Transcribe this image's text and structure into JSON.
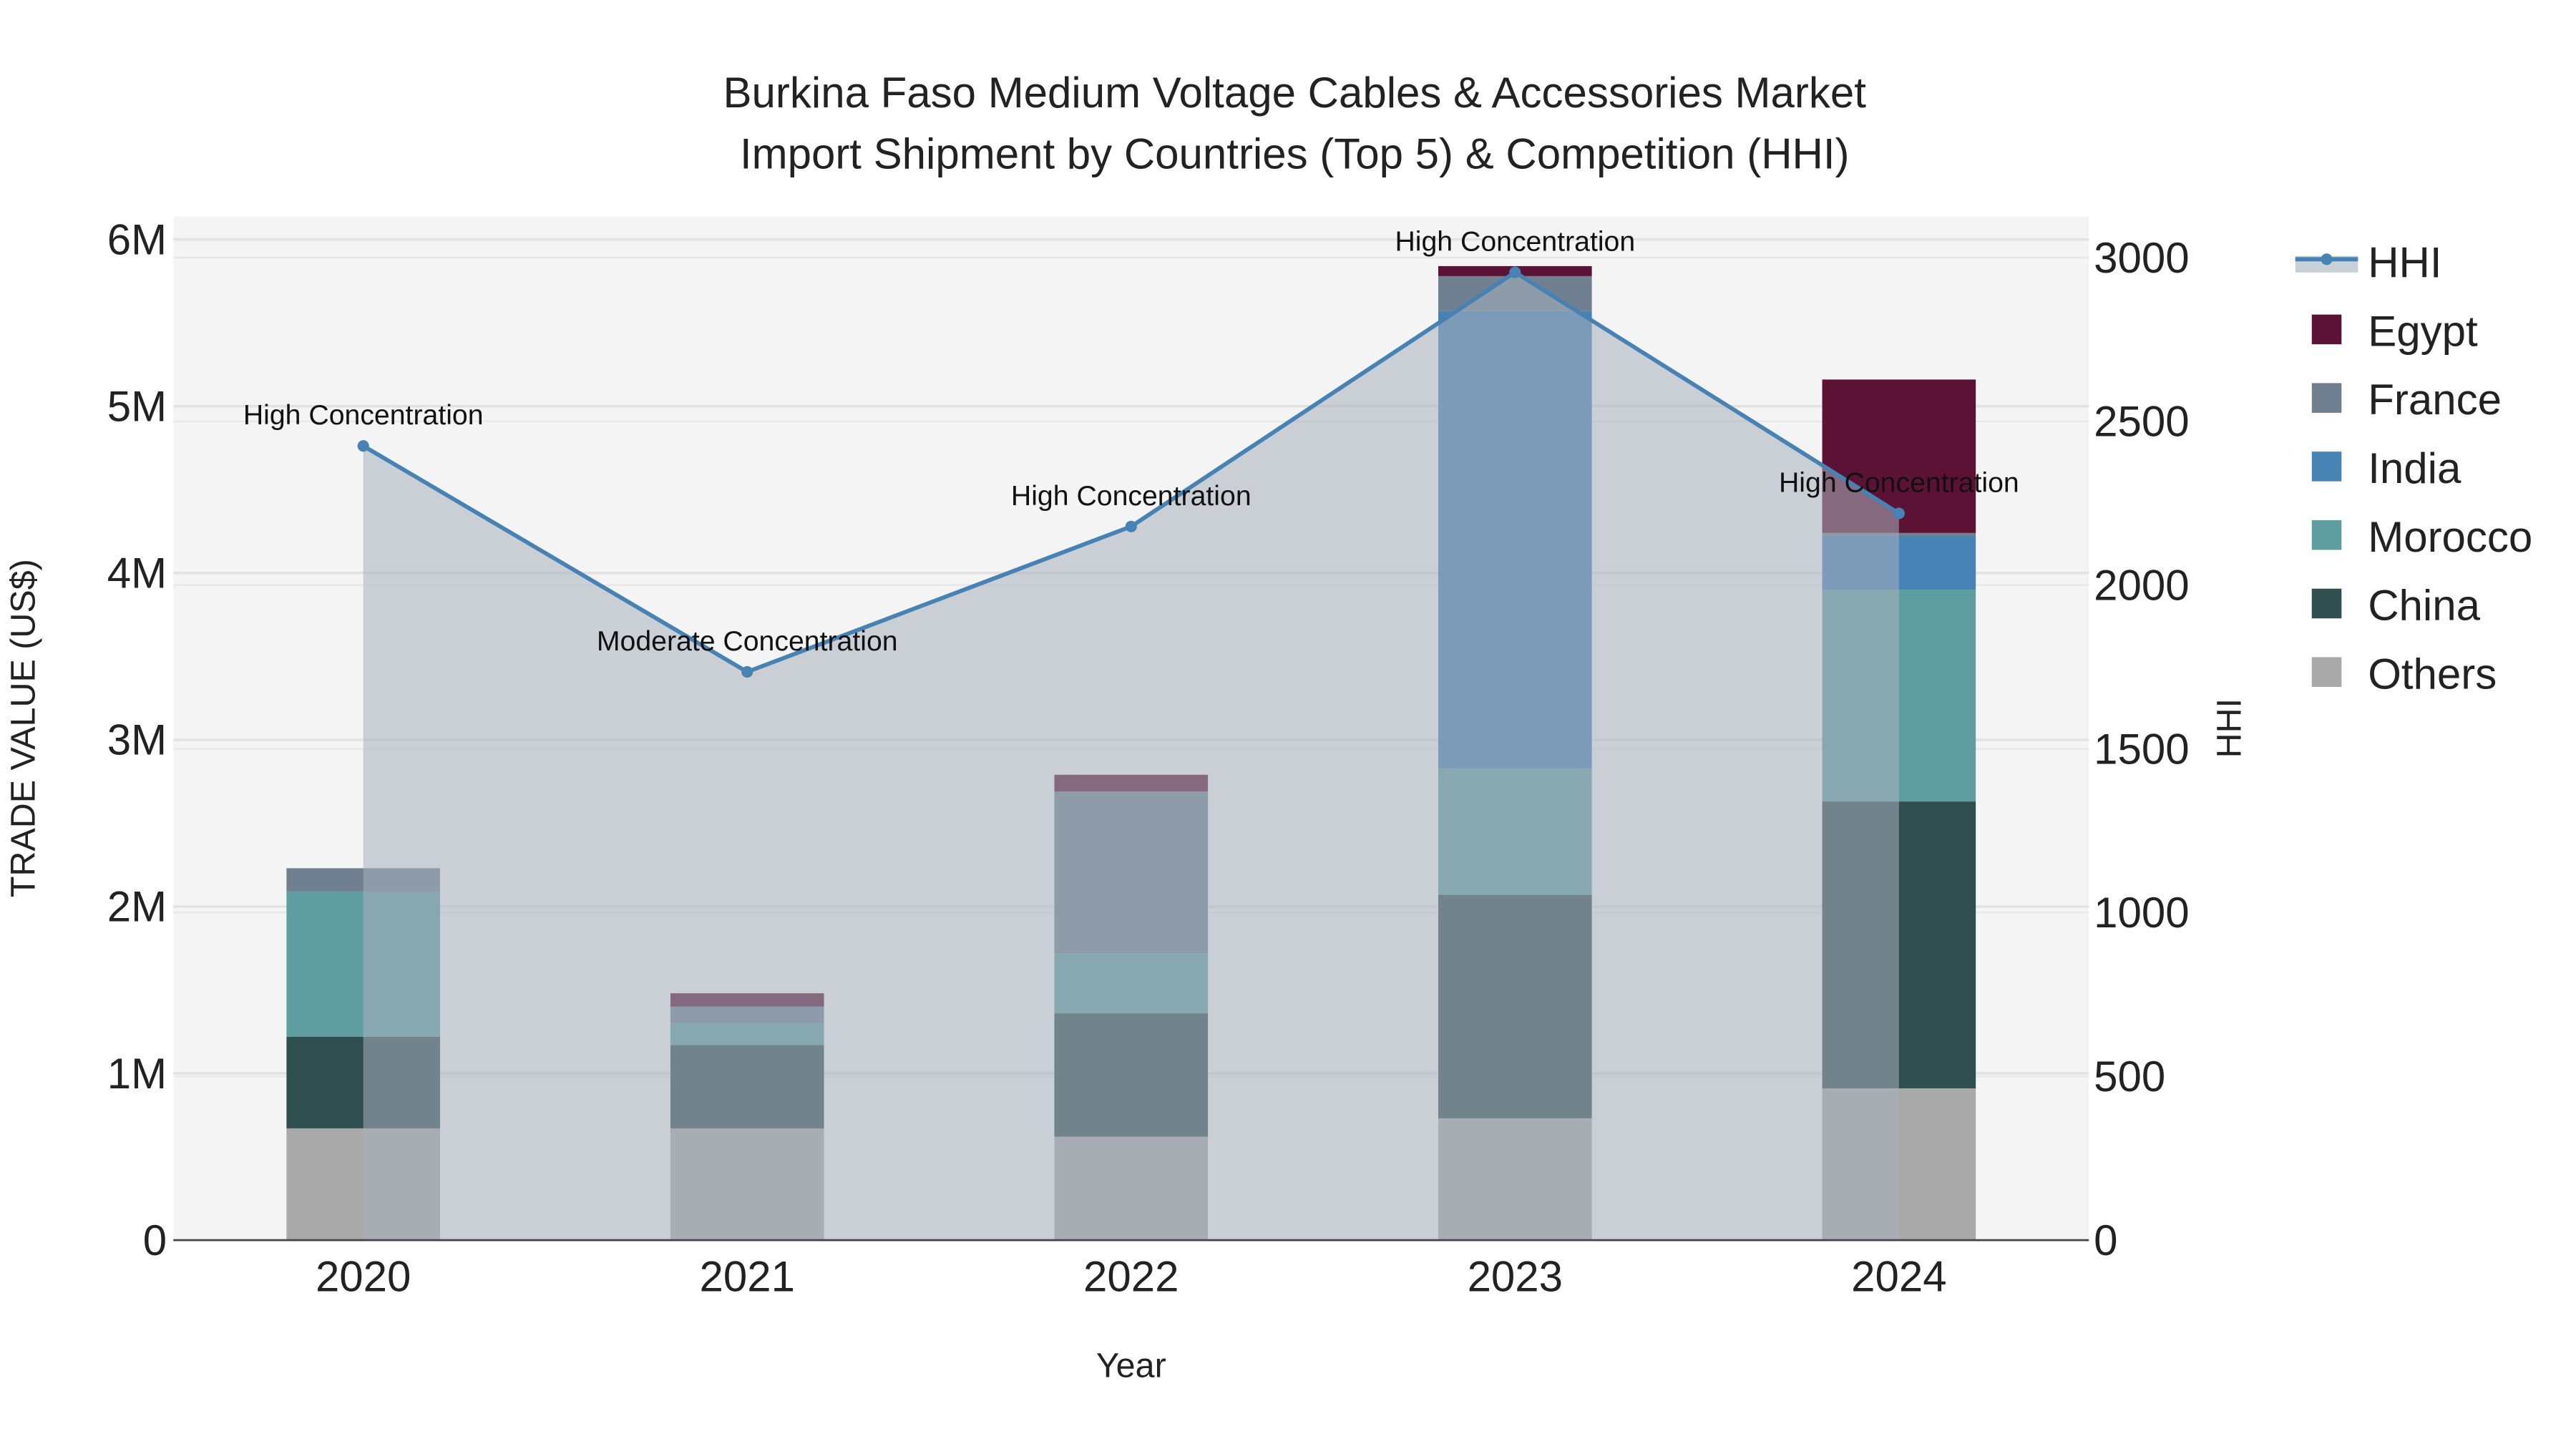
{
  "chart_data": {
    "type": "bar",
    "title": "Burkina Faso Medium Voltage Cables & Accessories Market",
    "subtitle": "Import Shipment by Countries (Top 5) & Competition (HHI)",
    "xlabel": "Year",
    "ylabel": "TRADE VALUE (US$)",
    "y2label": "HHI",
    "categories": [
      "2020",
      "2021",
      "2022",
      "2023",
      "2024"
    ],
    "ylim": [
      0,
      6100000
    ],
    "y2lim": [
      0,
      3050
    ],
    "yticks": [
      {
        "v": 0,
        "label": "0"
      },
      {
        "v": 1000000,
        "label": "1M"
      },
      {
        "v": 2000000,
        "label": "2M"
      },
      {
        "v": 3000000,
        "label": "3M"
      },
      {
        "v": 4000000,
        "label": "4M"
      },
      {
        "v": 5000000,
        "label": "5M"
      },
      {
        "v": 6000000,
        "label": "6M"
      }
    ],
    "y2ticks": [
      {
        "v": 0,
        "label": "0"
      },
      {
        "v": 500,
        "label": "500"
      },
      {
        "v": 1000,
        "label": "1000"
      },
      {
        "v": 1500,
        "label": "1500"
      },
      {
        "v": 2000,
        "label": "2000"
      },
      {
        "v": 2500,
        "label": "2500"
      },
      {
        "v": 3000,
        "label": "3000"
      }
    ],
    "grid": true,
    "legend_position": "right",
    "series": [
      {
        "name": "Others",
        "color": "#a9a9a9",
        "values": [
          670000,
          670000,
          620000,
          730000,
          910000
        ]
      },
      {
        "name": "China",
        "color": "#2f4f4f",
        "values": [
          550000,
          500000,
          740000,
          1340000,
          1720000
        ]
      },
      {
        "name": "Morocco",
        "color": "#5f9ea0",
        "values": [
          870000,
          130000,
          360000,
          760000,
          1270000
        ]
      },
      {
        "name": "India",
        "color": "#4682b4",
        "values": [
          0,
          0,
          0,
          2740000,
          320000
        ]
      },
      {
        "name": "France",
        "color": "#708090",
        "values": [
          140000,
          100000,
          970000,
          210000,
          20000
        ]
      },
      {
        "name": "Egypt",
        "color": "#5c1234",
        "values": [
          0,
          80000,
          100000,
          60000,
          920000
        ]
      }
    ],
    "hhi": {
      "name": "HHI",
      "color": "#4682b4",
      "values": [
        2425,
        1735,
        2179,
        2955,
        2219
      ],
      "annotations": [
        "High Concentration",
        "Moderate Concentration",
        "High Concentration",
        "High Concentration",
        "High Concentration"
      ]
    },
    "legend_order": [
      "HHI",
      "Egypt",
      "France",
      "India",
      "Morocco",
      "China",
      "Others"
    ]
  }
}
